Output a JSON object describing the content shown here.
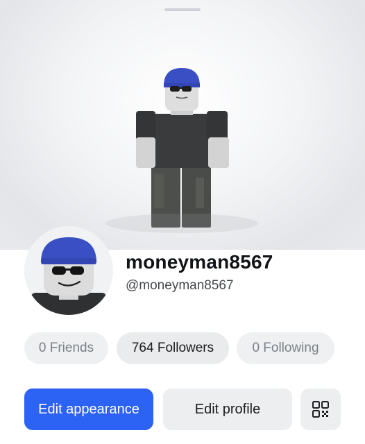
{
  "profile": {
    "display_name": "moneyman8567",
    "username": "@moneyman8567"
  },
  "stats": {
    "friends": "0 Friends",
    "followers": "764 Followers",
    "following": "0 Following"
  },
  "actions": {
    "edit_appearance": "Edit appearance",
    "edit_profile": "Edit profile"
  },
  "icons": {
    "qr": "qr-code-icon",
    "handle": "grab-handle"
  },
  "colors": {
    "primary": "#2c63f5",
    "pill": "#eef0f2",
    "hat": "#3b4fc4",
    "shirt": "#3a3b3d"
  }
}
